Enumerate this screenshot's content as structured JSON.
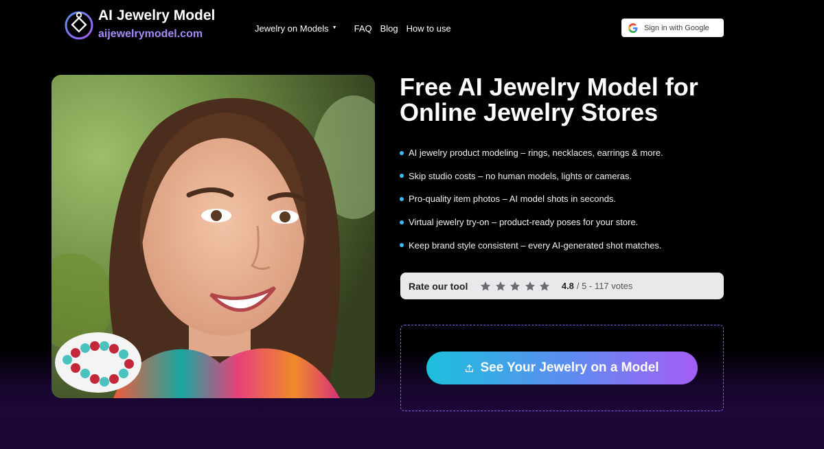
{
  "header": {
    "logo_title": "AI Jewelry Model",
    "logo_domain": "aijewelrymodel.com",
    "nav": {
      "models": "Jewelry on Models",
      "faq": "FAQ",
      "blog": "Blog",
      "how": "How to use"
    },
    "signin_label": "Sign in with Google"
  },
  "hero": {
    "headline_line1": "Free AI Jewelry Model for",
    "headline_line2": "Online Jewelry Stores",
    "features": [
      "AI jewelry product modeling – rings, necklaces, earrings & more.",
      "Skip studio costs – no human models, lights or cameras.",
      "Pro-quality item photos – AI model shots in seconds.",
      "Virtual jewelry try-on – product-ready poses for your store.",
      "Keep brand style consistent – every AI-generated shot matches."
    ],
    "rating": {
      "label": "Rate our tool",
      "score": "4.8",
      "rest": "/ 5 - 117 votes",
      "stars_filled": 5,
      "stars_total": 5
    },
    "cta_label": "See Your Jewelry on a Model"
  },
  "icons": {
    "logo": "pendant-logo-icon",
    "google": "google-g-icon",
    "caret": "caret-down-icon",
    "star": "star-icon",
    "upload": "upload-icon"
  },
  "colors": {
    "accent_purple": "#a78bfa",
    "bullet_blue": "#38bdf8",
    "cta_start": "#1cc0dc",
    "cta_end": "#a45ef5",
    "dashed_border": "#8b5cf6"
  }
}
